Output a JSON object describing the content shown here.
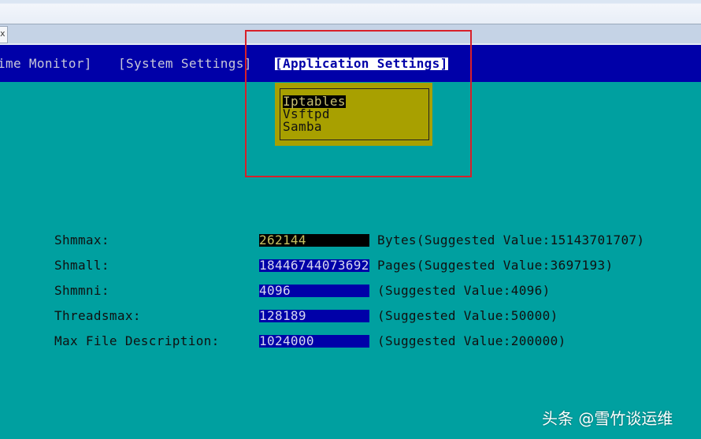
{
  "tab_close": "x",
  "menubar": {
    "items": [
      {
        "label": "[Realtime Monitor]",
        "visible_label": "ime Monitor]"
      },
      {
        "label": "[System Settings]"
      },
      {
        "label": "[Application Settings]",
        "active": true
      }
    ]
  },
  "dropdown": {
    "items": [
      "Iptables",
      "Vsftpd",
      "Samba"
    ],
    "selected": "Iptables"
  },
  "settings": [
    {
      "label": "Shmmax:",
      "value": "262144",
      "hint": "Bytes(Suggested Value:15143701707)"
    },
    {
      "label": "Shmall:",
      "value": "18446744073692",
      "hint": "Pages(Suggested Value:3697193)"
    },
    {
      "label": "Shmmni:",
      "value": "4096",
      "hint": "(Suggested Value:4096)"
    },
    {
      "label": "Threadsmax:",
      "value": "128189",
      "hint": "(Suggested Value:50000)"
    },
    {
      "label": "Max File Description:",
      "value": "1024000",
      "hint": "(Suggested Value:200000)"
    }
  ],
  "watermark": "头条 @雪竹谈运维",
  "colors": {
    "background": "#00a0a0",
    "menubar": "#0000a8",
    "dropdown": "#a8a000",
    "highlight_box": "#d8202a"
  }
}
